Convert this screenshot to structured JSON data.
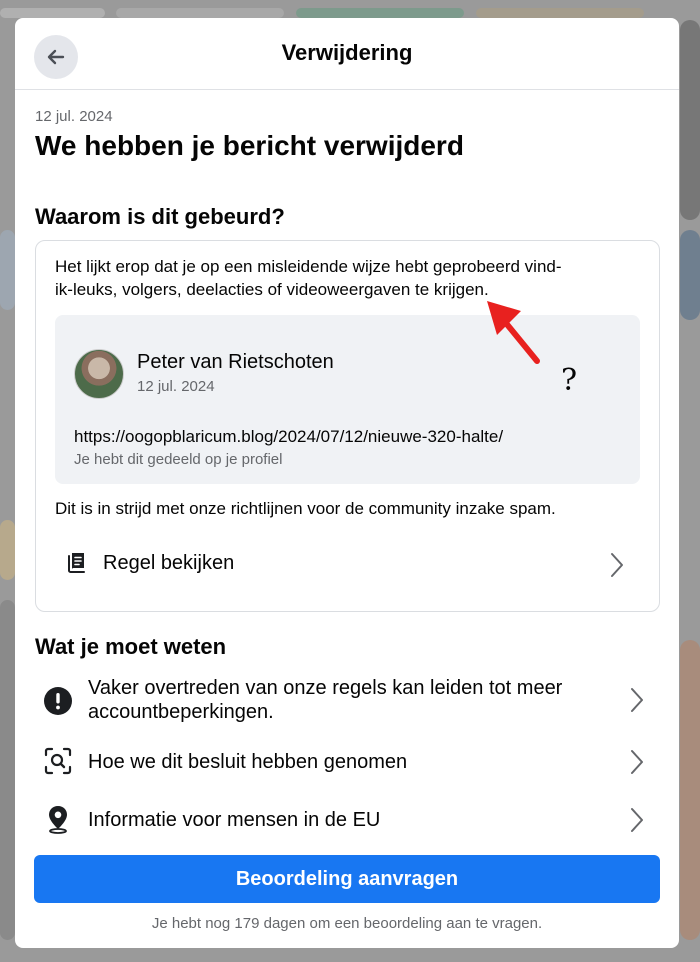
{
  "header": {
    "title": "Verwijdering"
  },
  "notice": {
    "date": "12 jul. 2024",
    "headline": "We hebben je bericht verwijderd"
  },
  "why": {
    "heading": "Waarom is dit gebeurd?",
    "reason_line1": "Het lijkt erop dat je op een misleidende wijze hebt geprobeerd vind-",
    "reason_line2": "ik-leuks, volgers, deelacties of videoweergaven te krijgen.",
    "post": {
      "author": "Peter van Rietschoten",
      "date": "12 jul. 2024",
      "annotation": "?",
      "url": "https://oogopblaricum.blog/2024/07/12/nieuwe-320-halte/",
      "shared_note": "Je hebt dit gedeeld op je profiel"
    },
    "violation": "Dit is in strijd met onze richtlijnen voor de community inzake spam.",
    "rule_link": "Regel bekijken"
  },
  "know": {
    "heading": "Wat je moet weten",
    "items": [
      {
        "label_line1": "Vaker overtreden van onze regels kan leiden tot meer",
        "label_line2": "accountbeperkingen.",
        "icon": "exclamation-circle-icon"
      },
      {
        "label_line1": "Hoe we dit besluit hebben genomen",
        "icon": "search-frame-icon"
      },
      {
        "label_line1": "Informatie voor mensen in de EU",
        "icon": "location-pin-icon"
      }
    ]
  },
  "actions": {
    "request_review": "Beoordeling aanvragen",
    "days_left": "Je hebt nog 179 dagen om een beoordeling aan te vragen."
  },
  "colors": {
    "primary": "#1877f2",
    "annotation_arrow": "#e8211f"
  }
}
